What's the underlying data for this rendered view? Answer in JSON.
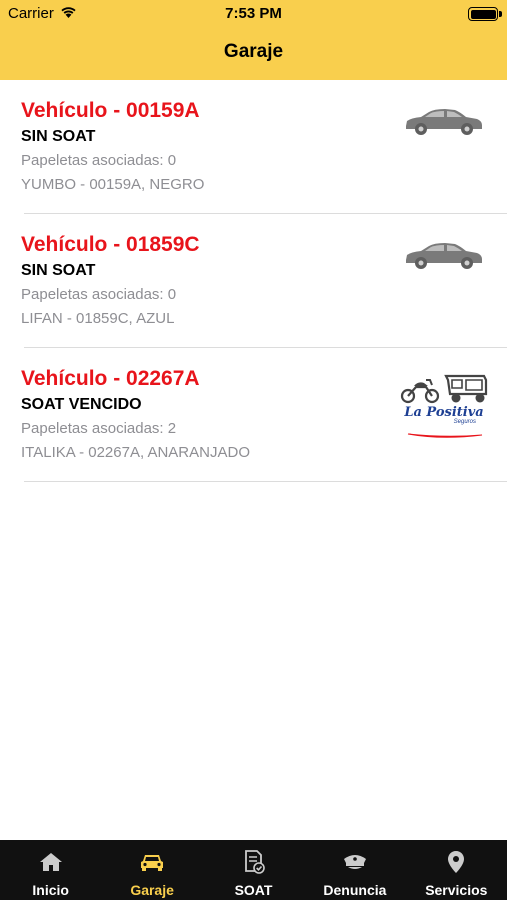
{
  "status_bar": {
    "carrier": "Carrier",
    "time": "7:53 PM"
  },
  "nav": {
    "title": "Garaje"
  },
  "vehicles": [
    {
      "plate": "Vehículo - 00159A",
      "soat": "SIN SOAT",
      "fines": "Papeletas asociadas: 0",
      "description": "YUMBO - 00159A, NEGRO",
      "icon": "car-icon"
    },
    {
      "plate": "Vehículo - 01859C",
      "soat": "SIN SOAT",
      "fines": "Papeletas asociadas: 0",
      "description": "LIFAN - 01859C, AZUL",
      "icon": "car-icon"
    },
    {
      "plate": "Vehículo - 02267A",
      "soat": "SOAT VENCIDO",
      "fines": "Papeletas asociadas: 2",
      "description": "ITALIKA - 02267A, ANARANJADO",
      "icon": "motorcycle-mototaxi-icon",
      "insurer_logo": {
        "name": "La Positiva",
        "sub": "Seguros"
      }
    }
  ],
  "tabs": [
    {
      "label": "Inicio",
      "icon": "home-icon",
      "active": false
    },
    {
      "label": "Garaje",
      "icon": "car-icon",
      "active": true
    },
    {
      "label": "SOAT",
      "icon": "document-check-icon",
      "active": false
    },
    {
      "label": "Denuncia",
      "icon": "police-cap-icon",
      "active": false
    },
    {
      "label": "Servicios",
      "icon": "location-pin-icon",
      "active": false
    }
  ],
  "colors": {
    "brand_yellow": "#f9cf4d",
    "plate_red": "#e8141b",
    "secondary_gray": "#8e8e93",
    "tabbar_bg": "#111111"
  }
}
